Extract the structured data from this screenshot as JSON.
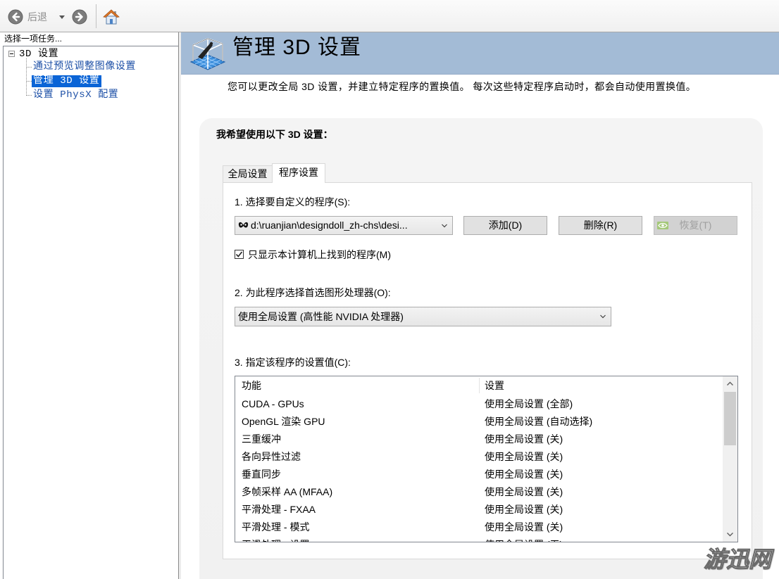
{
  "colors": {
    "header_band": "#a3bbd6",
    "selection": "#0a64d6",
    "tree_link": "#1c4fa6",
    "disabled_text": "#a0a0a0"
  },
  "toolbar": {
    "back_label": "后退",
    "back_enabled": false,
    "icons": [
      "back-arrow-icon",
      "history-dropdown-icon",
      "forward-arrow-icon",
      "home-icon"
    ]
  },
  "task_panel": {
    "header": "选择一项任务...",
    "tree": {
      "root": {
        "label": "3D 设置",
        "expanded": true,
        "icon": "tree-collapse-icon"
      },
      "children": [
        {
          "label": "通过预览调整图像设置",
          "selected": false
        },
        {
          "label": "管理 3D 设置",
          "selected": true
        },
        {
          "label": "设置 PhysX 配置",
          "selected": false
        }
      ]
    }
  },
  "page": {
    "icon": "3d-settings-icon",
    "title": "管理 3D 设置",
    "description": "您可以更改全局 3D 设置，并建立特定程序的置换值。 每次这些特定程序启动时，都会自动使用置换值。",
    "group_label": "我希望使用以下 3D 设置：",
    "tabs": [
      {
        "label": "全局设置",
        "active": false
      },
      {
        "label": "程序设置",
        "active": true
      }
    ],
    "step1": {
      "label": "1. 选择要自定义的程序(S):",
      "program": {
        "icon": "designdoll-app-icon",
        "value": "d:\\ruanjian\\designdoll_zh-chs\\desi..."
      },
      "buttons": {
        "add": {
          "label": "添加(D)",
          "enabled": true
        },
        "remove": {
          "label": "删除(R)",
          "enabled": true
        },
        "restore": {
          "label": "恢复(T)",
          "enabled": false,
          "icon": "nvidia-icon"
        }
      }
    },
    "only_found_programs": {
      "label": "只显示本计算机上找到的程序(M)",
      "checked": true
    },
    "step2": {
      "label": "2. 为此程序选择首选图形处理器(O):",
      "value": "使用全局设置 (高性能 NVIDIA 处理器)"
    },
    "step3": {
      "label": "3. 指定该程序的设置值(C):",
      "columns": [
        "功能",
        "设置"
      ],
      "rows": [
        {
          "feature": "CUDA - GPUs",
          "setting": "使用全局设置 (全部)"
        },
        {
          "feature": "OpenGL 渲染 GPU",
          "setting": "使用全局设置 (自动选择)"
        },
        {
          "feature": "三重缓冲",
          "setting": "使用全局设置 (关)"
        },
        {
          "feature": "各向异性过滤",
          "setting": "使用全局设置 (关)"
        },
        {
          "feature": "垂直同步",
          "setting": "使用全局设置 (关)"
        },
        {
          "feature": "多帧采样 AA (MFAA)",
          "setting": "使用全局设置 (关)"
        },
        {
          "feature": "平滑处理 - FXAA",
          "setting": "使用全局设置 (关)"
        },
        {
          "feature": "平滑处理 - 模式",
          "setting": "使用全局设置 (关)"
        },
        {
          "feature": "平滑处理 - 设置",
          "setting": "使用全局设置 (无)"
        }
      ]
    }
  },
  "watermark": "游迅网"
}
